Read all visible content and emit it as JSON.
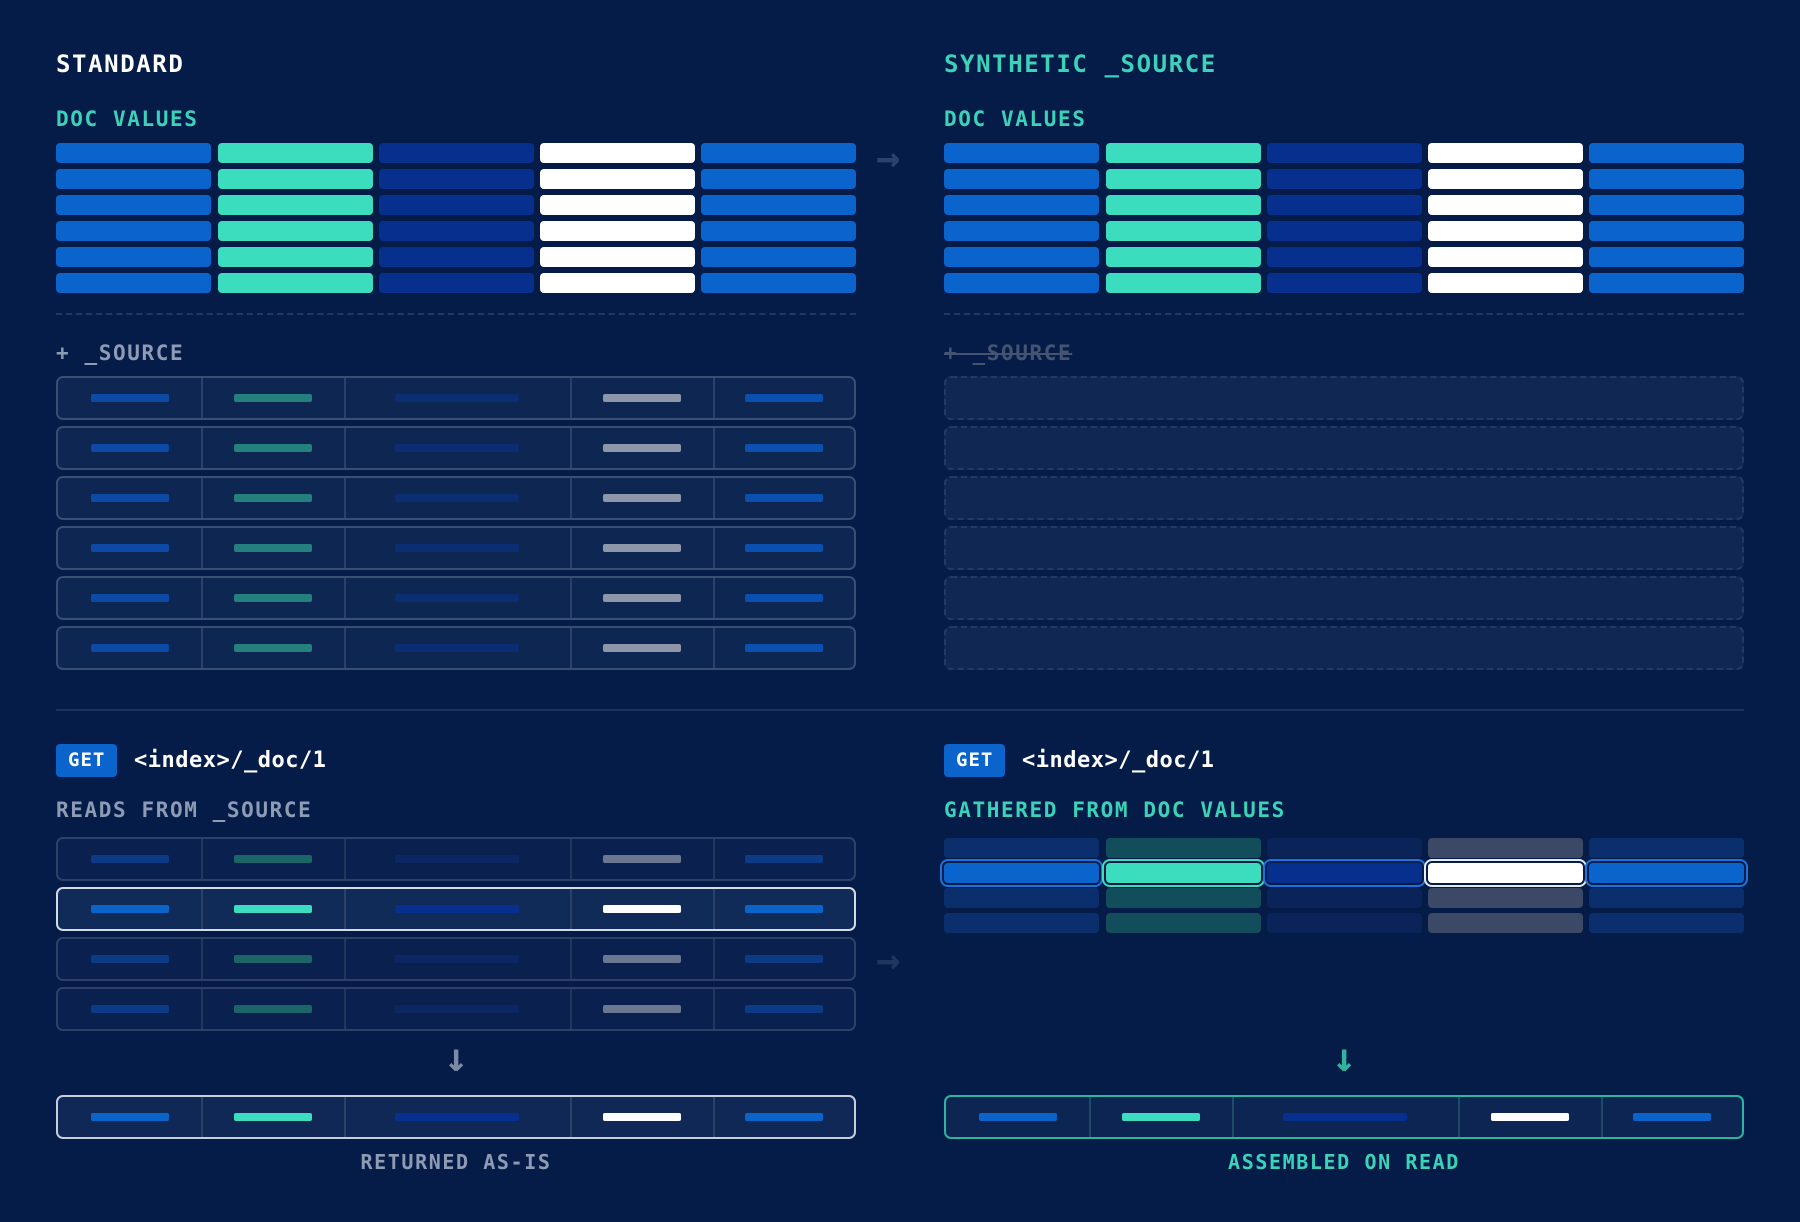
{
  "colors": {
    "background": "#061c48",
    "blue": "#0b64cc",
    "teal": "#3cdcbf",
    "navy": "#062f8e",
    "white": "#ffffff",
    "accent_teal_text": "#3cd2b9",
    "muted_text": "#8d9bb5"
  },
  "standard": {
    "title": "STANDARD",
    "doc_values_label": "DOC VALUES",
    "source_label": "+ _SOURCE",
    "get_badge": "GET",
    "get_path": "<index>/_doc/1",
    "reads_label": "READS FROM _SOURCE",
    "result_label": "RETURNED AS-IS"
  },
  "synthetic": {
    "title": "SYNTHETIC _SOURCE",
    "doc_values_label": "DOC VALUES",
    "source_label": "+ _SOURCE",
    "get_badge": "GET",
    "get_path": "<index>/_doc/1",
    "gathered_label": "GATHERED FROM DOC VALUES",
    "result_label": "ASSEMBLED ON READ"
  },
  "icons": {
    "arrow_right": "→",
    "arrow_down": "↓"
  }
}
